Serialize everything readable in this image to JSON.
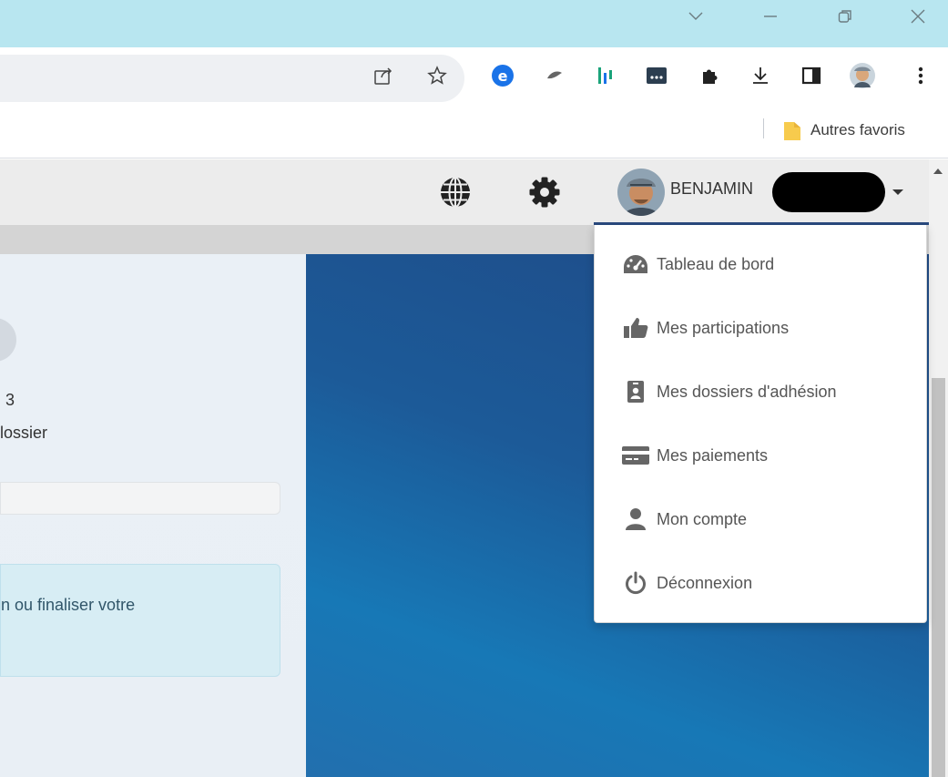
{
  "bookmarks_bar": {
    "folder_label": "Autres favoris"
  },
  "user_menu": {
    "user_name": "BENJAMIN",
    "items": [
      {
        "label": "Tableau de bord",
        "icon": "dashboard-icon"
      },
      {
        "label": "Mes participations",
        "icon": "thumbs-up-icon"
      },
      {
        "label": "Mes dossiers d'adhésion",
        "icon": "id-badge-icon"
      },
      {
        "label": "Mes paiements",
        "icon": "credit-card-icon"
      },
      {
        "label": "Mon compte",
        "icon": "user-icon"
      },
      {
        "label": "Déconnexion",
        "icon": "power-icon"
      }
    ]
  },
  "left_panel": {
    "line_1": "3",
    "line_2": "lossier",
    "alert_text": "n ou finaliser votre"
  },
  "colors": {
    "accent": "#2a4a7e",
    "titlebar": "#b8e6f0",
    "hero_blue": "#1c5a98"
  }
}
